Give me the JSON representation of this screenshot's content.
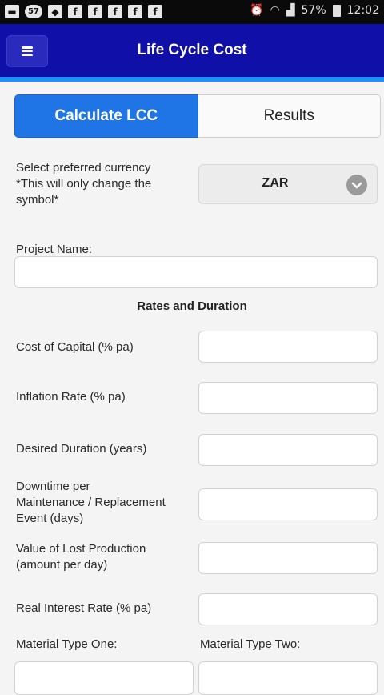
{
  "status_bar": {
    "battery_text": "57%",
    "time": "12:02",
    "notification_badge": "57"
  },
  "app": {
    "title": "Life Cycle Cost"
  },
  "tabs": {
    "calculate": "Calculate LCC",
    "results": "Results"
  },
  "currency": {
    "label_line1": "Select preferred currency",
    "label_line2": "*This will only change the",
    "label_line3": "symbol*",
    "selected": "ZAR"
  },
  "project": {
    "label": "Project Name:",
    "value": ""
  },
  "section_heading": "Rates and Duration",
  "fields": {
    "cost_of_capital": "Cost of Capital (% pa)",
    "inflation_rate": "Inflation Rate (% pa)",
    "desired_duration": "Desired Duration (years)",
    "downtime_line1": "Downtime per",
    "downtime_line2": "Maintenance / Replacement",
    "downtime_line3": "Event (days)",
    "lost_prod_line1": "Value of Lost Production",
    "lost_prod_line2": "(amount per day)",
    "real_interest_rate": "Real Interest Rate (% pa)"
  },
  "material": {
    "type_one": "Material Type One:",
    "type_two": "Material Type Two:"
  }
}
